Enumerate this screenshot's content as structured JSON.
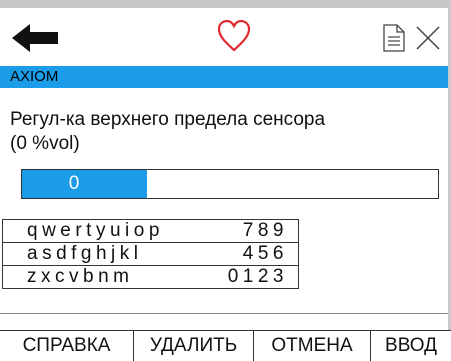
{
  "header": {
    "section_title": "AXIOM"
  },
  "toolbar": {
    "back_icon": "back-arrow-icon",
    "favorite_icon": "heart-icon",
    "document_icon": "document-icon",
    "close_icon": "close-icon",
    "favorite_color": "#e0282e"
  },
  "setting": {
    "description_line1": "Регул-ка верхнего предела сенсора",
    "description_line2": "(0 %vol)",
    "value": "0",
    "fill_fraction": 0.3
  },
  "keyboard": {
    "rows": [
      {
        "letters": "qwertyuiop",
        "digits": "789"
      },
      {
        "letters": "asdfghjkl",
        "digits": "456"
      },
      {
        "letters": "zxcvbnm",
        "digits": "0123"
      }
    ]
  },
  "softkeys": {
    "help": "СПРАВКА",
    "delete": "УДАЛИТЬ",
    "cancel": "ОТМЕНА",
    "enter": "ВВОД"
  },
  "colors": {
    "accent": "#1b9ce8"
  }
}
